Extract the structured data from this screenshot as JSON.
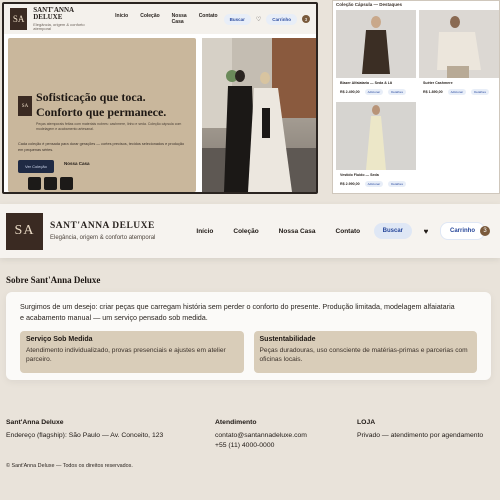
{
  "brand": {
    "logo": "SA",
    "name": "SANT'ANNA DELUXE",
    "tagline": "Elegância, origem & conforto atemporal"
  },
  "nav": {
    "links": [
      "Início",
      "Coleção",
      "Nossa Casa",
      "Contato"
    ],
    "search_label": "Buscar",
    "wishlist_icon": "heart-icon",
    "cart_label": "Carrinho",
    "cart_count": "3"
  },
  "hero": {
    "title_line1": "Sofisticação que toca.",
    "title_line2": "Conforto que permanece.",
    "intro": "Peças atemporais feitas com materiais nobres: cashmere, linho e seda. Coleção cápsula com modelagem e acabamento artesanal.",
    "description": "Cada coleção é pensada para durar gerações — cortes precisos, tecidos selecionados e produção em pequenas séries.",
    "cta_primary": "Ver Coleção",
    "cta_secondary": "Nossa Casa"
  },
  "collection": {
    "heading": "Coleção Cápsula — Destaques",
    "items": [
      {
        "name": "Blazer Alfaiataria — Seda & Lã",
        "price": "R$ 2.490,00",
        "add": "Adicionar",
        "view": "Detalhes"
      },
      {
        "name": "Suéter Cashmere",
        "price": "R$ 1.890,00",
        "add": "Adicionar",
        "view": "Detalhes"
      },
      {
        "name": "Vestido Fluido — Seda",
        "price": "R$ 2.990,00",
        "add": "Adicionar",
        "view": "Detalhes"
      }
    ]
  },
  "about": {
    "title": "Sobre Sant'Anna Deluxe",
    "text": "Surgimos de um desejo: criar peças que carregam história sem perder o conforto do presente. Produção limitada, modelagem alfaiataria e acabamento manual — um serviço pensado sob medida.",
    "services": [
      {
        "title": "Serviço Sob Medida",
        "text": "Atendimento individualizado, provas presenciais e ajustes em atelier parceiro."
      },
      {
        "title": "Sustentabilidade",
        "text": "Peças duradouras, uso consciente de matérias-primas e parcerias com oficinas locais."
      }
    ]
  },
  "footer": {
    "company": {
      "heading": "Sant'Anna Deluxe",
      "line": "Endereço (flagship): São Paulo — Av. Conceito, 123"
    },
    "service": {
      "heading": "Atendimento",
      "email": "contato@santannadeluxe.com",
      "phone": "+55 (11) 4000-0000"
    },
    "store": {
      "heading": "LOJA",
      "line": "Privado — atendimento por agendamento"
    },
    "copyright": "© Sant'Anna Deluxe — Todos os direitos reservados."
  },
  "colors": {
    "accent": "#27479a",
    "brand_dark": "#3a2a22",
    "card_beige": "#d9cdb9",
    "page_bg": "#e9e3da"
  }
}
